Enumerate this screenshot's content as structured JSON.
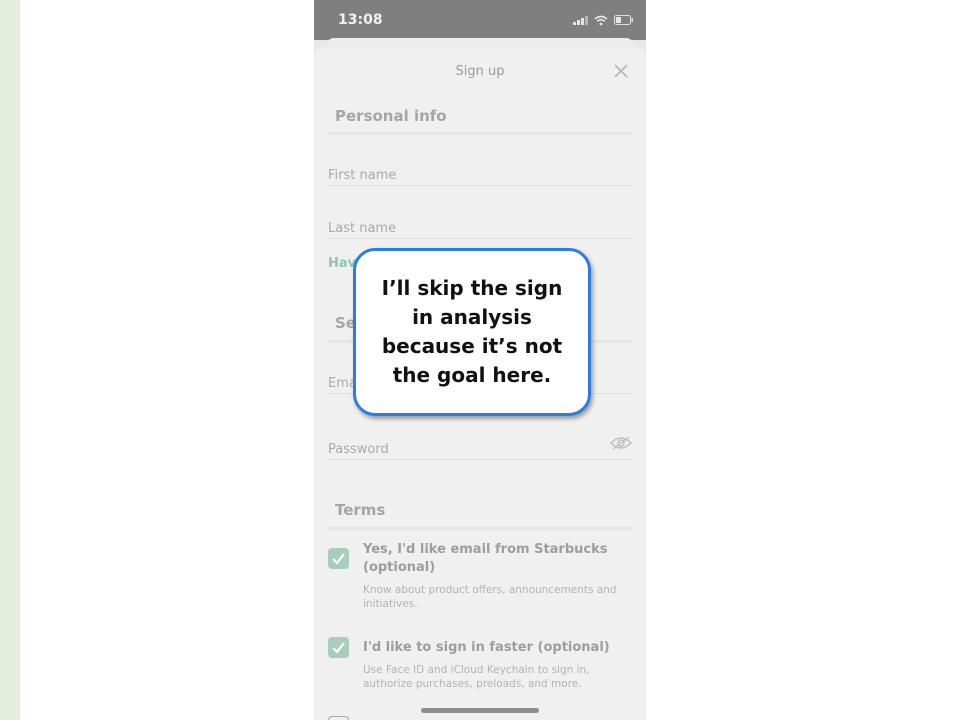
{
  "status_bar": {
    "time": "13:08"
  },
  "sheet": {
    "title": "Sign up"
  },
  "personal_info": {
    "heading": "Personal info",
    "first_name_label": "First name",
    "last_name_label": "Last name",
    "have_link": "Have"
  },
  "security": {
    "heading": "Se",
    "email_label": "Ema",
    "password_label": "Password"
  },
  "terms": {
    "heading": "Terms",
    "options": [
      {
        "title": "Yes, I'd like email from Starbucks (optional)",
        "description": "Know about product offers, announcements and initiatives.",
        "checked": true
      },
      {
        "title": "I'd like to sign in faster (optional)",
        "description": "Use Face ID and iCloud Keychain to sign in, authorize purchases, preloads, and more.",
        "checked": true
      }
    ]
  },
  "callout": {
    "text": "I’ll skip the sign in analysis because it’s not the goal here."
  },
  "colors": {
    "accent": "#2b7de1",
    "check": "#a9cdbc",
    "side_bar": "#e3eedc"
  }
}
